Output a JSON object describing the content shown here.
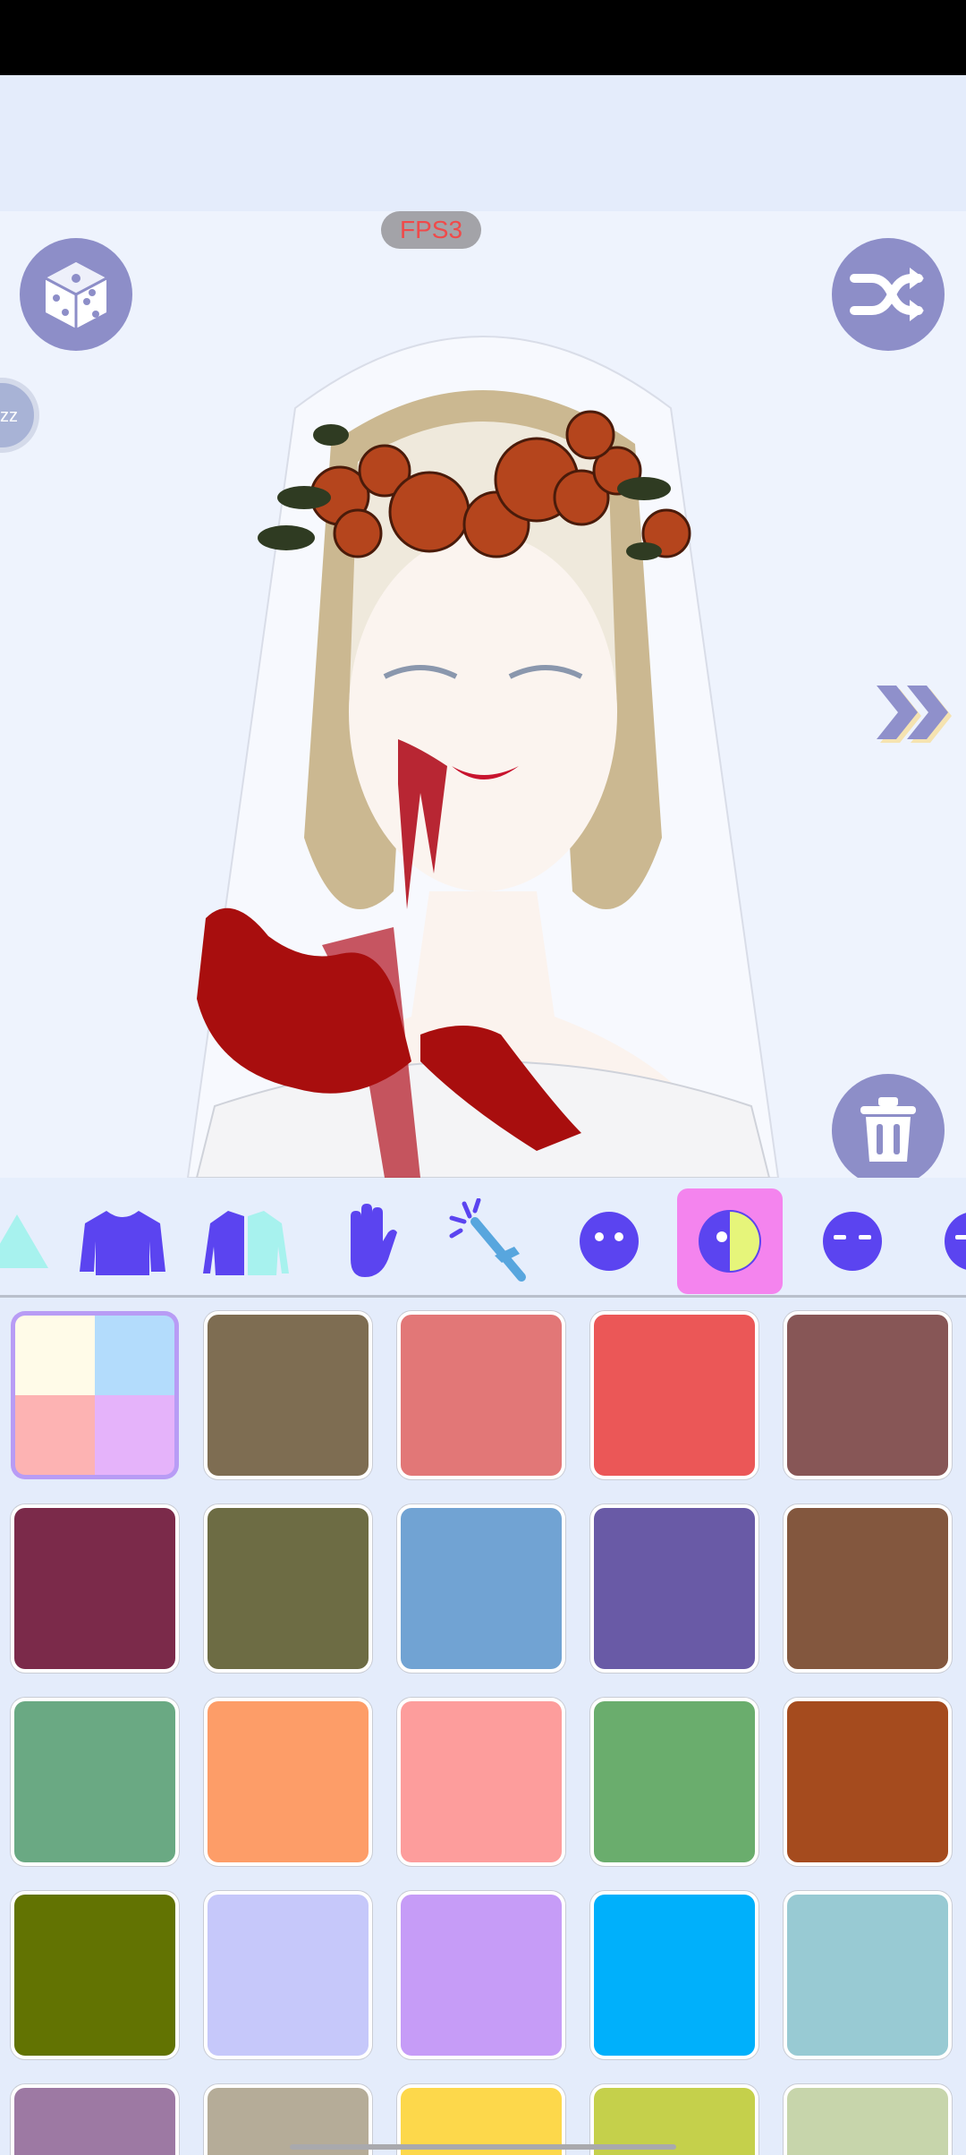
{
  "fps_label": "FPS3",
  "zz_label": "zz",
  "toolbar": {
    "tools": [
      {
        "name": "shape-icon",
        "active": false
      },
      {
        "name": "sweater-icon",
        "active": false
      },
      {
        "name": "jacket-icon",
        "active": false
      },
      {
        "name": "hand-icon",
        "active": false
      },
      {
        "name": "wand-icon",
        "active": false
      },
      {
        "name": "face-icon",
        "active": false
      },
      {
        "name": "color-mix-icon",
        "active": true
      },
      {
        "name": "eyes-icon",
        "active": false
      },
      {
        "name": "mouth-icon",
        "active": false
      }
    ]
  },
  "palette": {
    "multicolor": [
      "#fffbe8",
      "#b3dcfc",
      "#fdb3b3",
      "#e5b3fa"
    ],
    "colors": [
      "#7e6d52",
      "#e27777",
      "#eb5757",
      "#875656",
      "#7b2a4a",
      "#6d6c44",
      "#71a3d3",
      "#695aa6",
      "#83573e",
      "#6aa983",
      "#fd9d68",
      "#fd9d9c",
      "#6aad6d",
      "#a54b1e",
      "#627302",
      "#c6c8fa",
      "#c69cf7",
      "#00b0fb",
      "#98cad3",
      "#9d79a3",
      "#b5ac98",
      "#fdd84b",
      "#c5d04b",
      "#c7d5ab"
    ]
  }
}
